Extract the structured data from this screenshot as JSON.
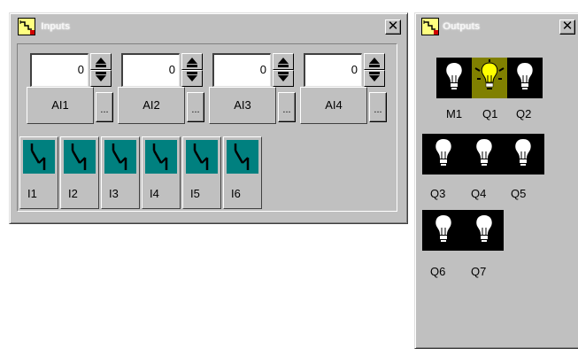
{
  "inputs_window": {
    "title": "Inputs",
    "close_glyph": "✕",
    "analog_inputs": [
      {
        "value": "0",
        "label": "AI1",
        "more_label": "..."
      },
      {
        "value": "0",
        "label": "AI2",
        "more_label": "..."
      },
      {
        "value": "0",
        "label": "AI3",
        "more_label": "..."
      },
      {
        "value": "0",
        "label": "AI4",
        "more_label": "..."
      }
    ],
    "digital_inputs": [
      {
        "label": "I1",
        "icon": "switch-icon"
      },
      {
        "label": "I2",
        "icon": "switch-icon"
      },
      {
        "label": "I3",
        "icon": "switch-icon"
      },
      {
        "label": "I4",
        "icon": "switch-icon"
      },
      {
        "label": "I5",
        "icon": "switch-icon"
      },
      {
        "label": "I6",
        "icon": "switch-icon"
      }
    ]
  },
  "outputs_window": {
    "title": "Outputs",
    "close_glyph": "✕",
    "outputs": [
      {
        "label": "M1",
        "state": "off",
        "icon": "bulb-icon"
      },
      {
        "label": "Q1",
        "state": "on",
        "icon": "bulb-lit-icon"
      },
      {
        "label": "Q2",
        "state": "off",
        "icon": "bulb-icon"
      },
      {
        "label": "Q3",
        "state": "off",
        "icon": "bulb-icon"
      },
      {
        "label": "Q4",
        "state": "off",
        "icon": "bulb-icon"
      },
      {
        "label": "Q5",
        "state": "off",
        "icon": "bulb-icon"
      },
      {
        "label": "Q6",
        "state": "off",
        "icon": "bulb-icon"
      },
      {
        "label": "Q7",
        "state": "off",
        "icon": "bulb-icon"
      }
    ]
  },
  "colors": {
    "face": "#c0c0c0",
    "switch_bg": "#00807f",
    "bulb_on_bg": "#808000",
    "bulb_on": "#ffff00"
  }
}
